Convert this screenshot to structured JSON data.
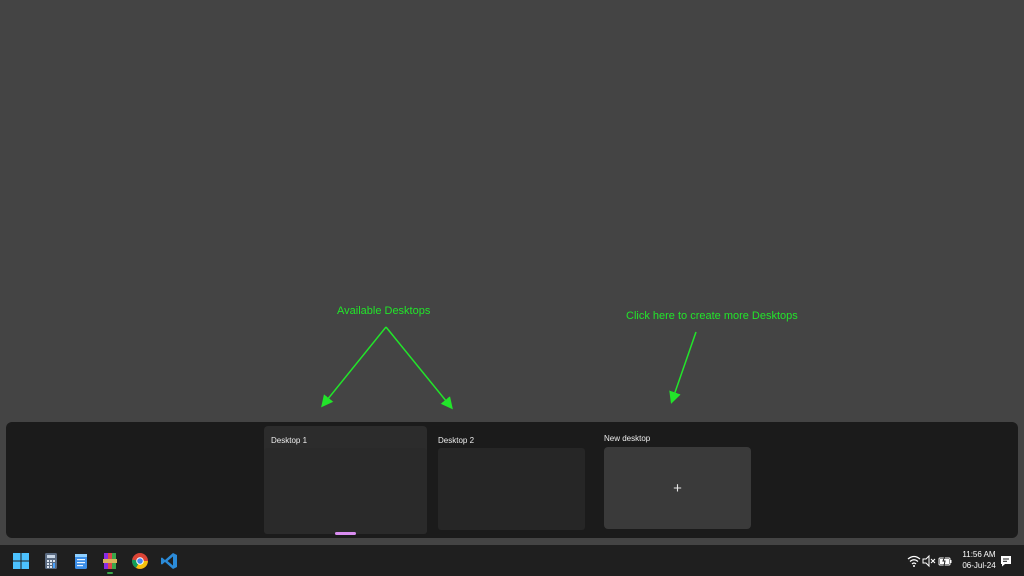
{
  "annotations": {
    "available": "Available Desktops",
    "create": "Click here to create more Desktops"
  },
  "desktops": [
    {
      "label": "Desktop 1",
      "active": true
    },
    {
      "label": "Desktop 2",
      "active": false
    }
  ],
  "new_desktop": {
    "label": "New desktop",
    "icon": "plus-icon"
  },
  "taskbar": {
    "apps": [
      "start-icon",
      "calculator-icon",
      "notepad-icon",
      "winrar-icon",
      "chrome-icon",
      "vscode-icon"
    ],
    "tray": [
      "wifi-icon",
      "volume-muted-icon",
      "battery-charging-icon",
      "notifications-icon"
    ],
    "clock": {
      "time": "11:56 AM",
      "date": "06-Jul-24"
    }
  },
  "colors": {
    "annotation": "#22e52a",
    "active_indicator": "#d98df0",
    "background": "#444444"
  }
}
